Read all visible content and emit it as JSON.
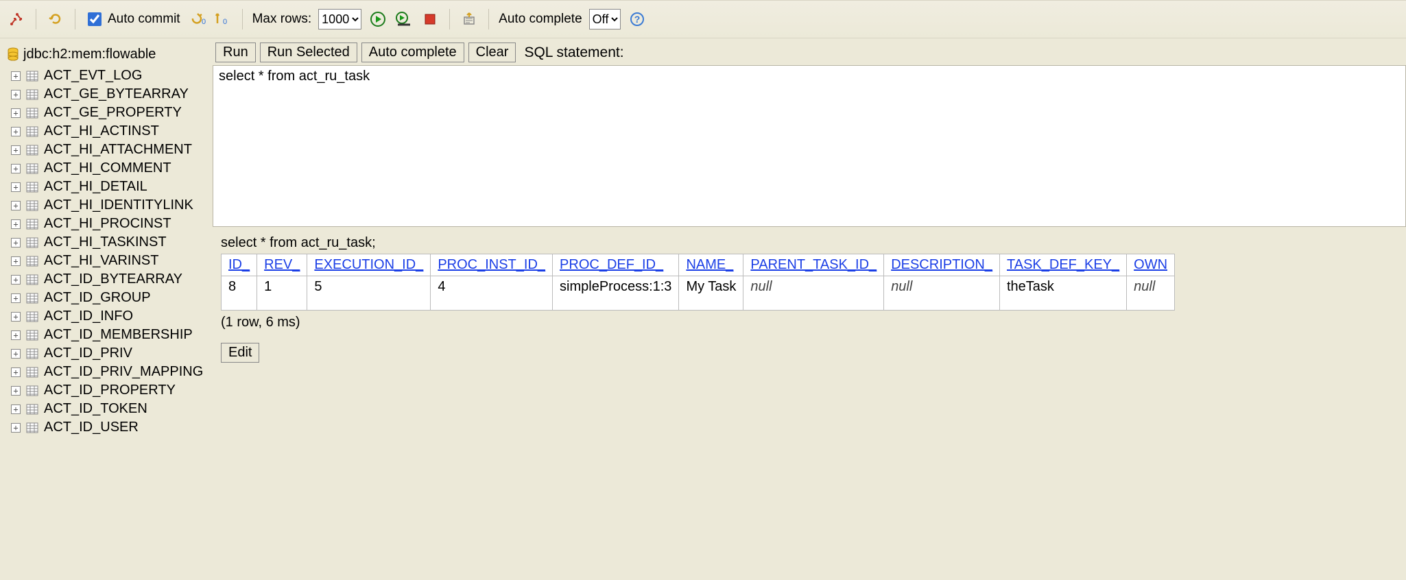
{
  "toolbar": {
    "autocommit_label": "Auto commit",
    "autocommit_checked": true,
    "max_rows_label": "Max rows:",
    "max_rows_value": "1000",
    "autocomplete_label": "Auto complete",
    "autocomplete_value": "Off"
  },
  "sidebar": {
    "connection": "jdbc:h2:mem:flowable",
    "tables": [
      "ACT_EVT_LOG",
      "ACT_GE_BYTEARRAY",
      "ACT_GE_PROPERTY",
      "ACT_HI_ACTINST",
      "ACT_HI_ATTACHMENT",
      "ACT_HI_COMMENT",
      "ACT_HI_DETAIL",
      "ACT_HI_IDENTITYLINK",
      "ACT_HI_PROCINST",
      "ACT_HI_TASKINST",
      "ACT_HI_VARINST",
      "ACT_ID_BYTEARRAY",
      "ACT_ID_GROUP",
      "ACT_ID_INFO",
      "ACT_ID_MEMBERSHIP",
      "ACT_ID_PRIV",
      "ACT_ID_PRIV_MAPPING",
      "ACT_ID_PROPERTY",
      "ACT_ID_TOKEN",
      "ACT_ID_USER"
    ]
  },
  "statement": {
    "buttons": {
      "run": "Run",
      "run_selected": "Run Selected",
      "autocomplete": "Auto complete",
      "clear": "Clear"
    },
    "label": "SQL statement:",
    "text": "select * from act_ru_task"
  },
  "result": {
    "executed_sql": "select * from act_ru_task;",
    "columns": [
      "ID_",
      "REV_",
      "EXECUTION_ID_",
      "PROC_INST_ID_",
      "PROC_DEF_ID_",
      "NAME_",
      "PARENT_TASK_ID_",
      "DESCRIPTION_",
      "TASK_DEF_KEY_",
      "OWN"
    ],
    "rows": [
      [
        "8",
        "1",
        "5",
        "4",
        "",
        "simpleProcess:1:3",
        "My Task",
        null,
        null,
        "theTask",
        null
      ]
    ],
    "row_wrap": [
      {
        "v": "8"
      },
      {
        "v": "1"
      },
      {
        "v": "5"
      },
      {
        "v": "4"
      },
      {
        "v": ""
      },
      {
        "v": "simpleProcess:1:3"
      },
      {
        "v": "My Task"
      },
      {
        "v": "null",
        "null": true
      },
      {
        "v": "null",
        "null": true
      },
      {
        "v": "theTask"
      },
      {
        "v": "null",
        "null": true
      }
    ],
    "info": "(1 row, 6 ms)",
    "edit": "Edit"
  }
}
